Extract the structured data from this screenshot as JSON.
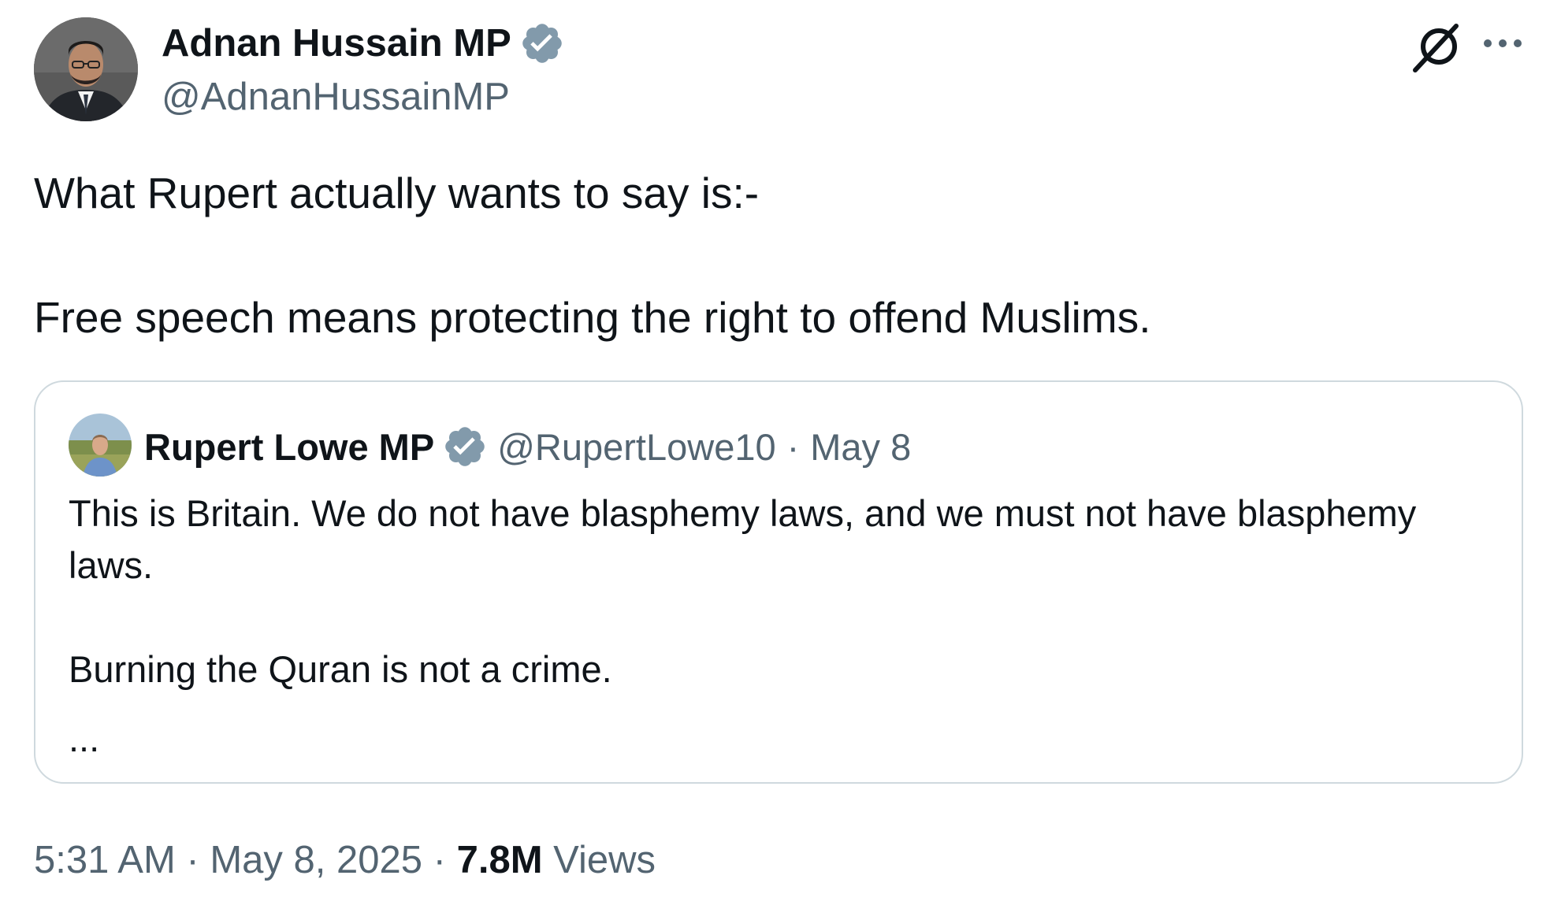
{
  "author": {
    "name": "Adnan Hussain MP",
    "handle": "@AdnanHussainMP",
    "verified": true
  },
  "tweet": {
    "line1": "What Rupert actually wants to say is:-",
    "line2": "Free speech means protecting the right to offend Muslims."
  },
  "quoted": {
    "name": "Rupert Lowe MP",
    "handle": "@RupertLowe10",
    "separator": "·",
    "date": "May 8",
    "verified": true,
    "paragraph1": "This is Britain. We do not have blasphemy laws, and we must not have blasphemy laws.",
    "paragraph2": "Burning the Quran is not a crime.",
    "ellipsis": "..."
  },
  "meta": {
    "time": "5:31 AM",
    "sep1": "·",
    "date": "May 8, 2025",
    "sep2": "·",
    "views_count": "7.8M",
    "views_label": "Views"
  },
  "icons": {
    "verified": "verified-badge-icon",
    "grok": "grok-icon",
    "more": "more-icon"
  },
  "colors": {
    "text": "#0f1419",
    "secondary": "#536471",
    "border": "#cfd9de",
    "verified_badge": "#829aab"
  }
}
